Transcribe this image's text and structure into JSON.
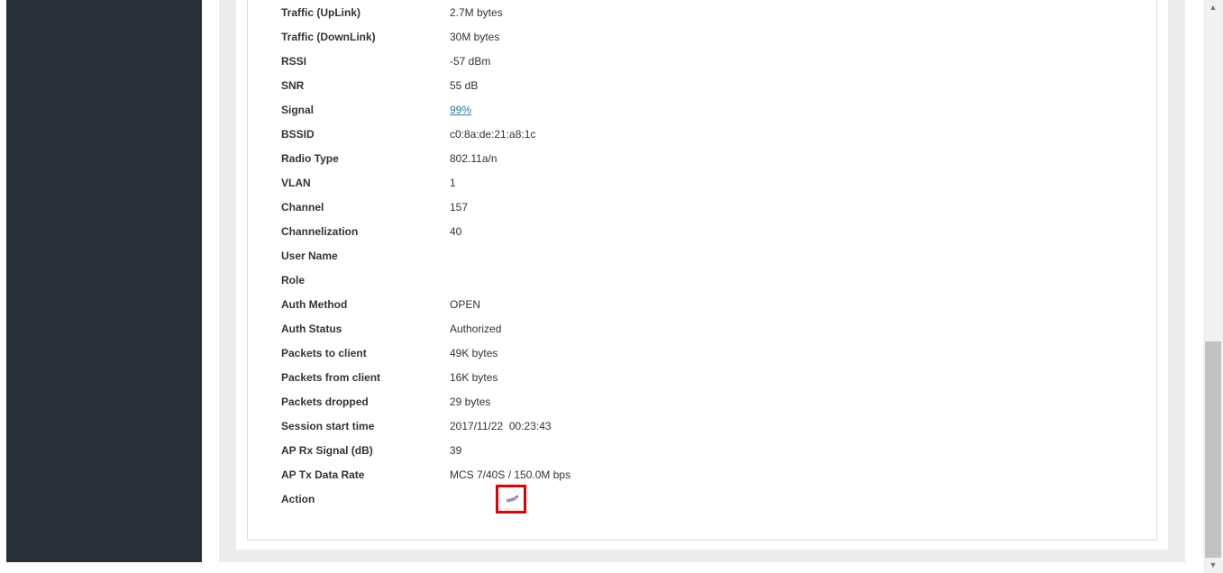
{
  "details": [
    {
      "label": "Traffic (UpLink)",
      "value": "2.7M bytes"
    },
    {
      "label": "Traffic (DownLink)",
      "value": "30M bytes"
    },
    {
      "label": "RSSI",
      "value": "-57 dBm"
    },
    {
      "label": "SNR",
      "value": "55 dB"
    },
    {
      "label": "Signal",
      "value": "99%",
      "is_link": true
    },
    {
      "label": "BSSID",
      "value": "c0:8a:de:21:a8:1c"
    },
    {
      "label": "Radio Type",
      "value": "802.11a/n"
    },
    {
      "label": "VLAN",
      "value": "1"
    },
    {
      "label": "Channel",
      "value": "157"
    },
    {
      "label": "Channelization",
      "value": "40"
    },
    {
      "label": "User Name",
      "value": ""
    },
    {
      "label": "Role",
      "value": ""
    },
    {
      "label": "Auth Method",
      "value": "OPEN"
    },
    {
      "label": "Auth Status",
      "value": "Authorized"
    },
    {
      "label": "Packets to client",
      "value": "49K bytes"
    },
    {
      "label": "Packets from client",
      "value": "16K bytes"
    },
    {
      "label": "Packets dropped",
      "value": "29 bytes"
    },
    {
      "label": "Session start time",
      "value": "2017/11/22  00:23:43"
    },
    {
      "label": "AP Rx Signal (dB)",
      "value": "39"
    },
    {
      "label": "AP Tx Data Rate",
      "value": "MCS 7/40S / 150.0M bps"
    }
  ],
  "action": {
    "label": "Action",
    "icon": "chart-trend-icon"
  },
  "colors": {
    "sidebar": "#2a3038",
    "link": "#2a7ab0",
    "highlight": "#e00000"
  }
}
